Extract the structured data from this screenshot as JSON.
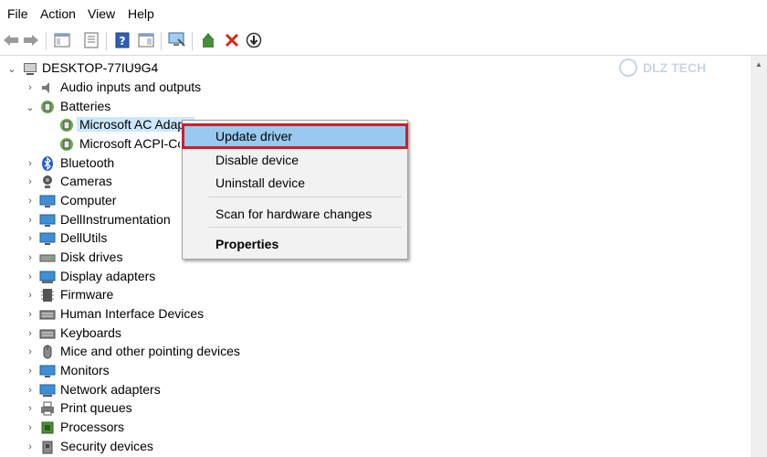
{
  "menubar": {
    "items": [
      "File",
      "Action",
      "View",
      "Help"
    ]
  },
  "toolbar": {
    "buttons": [
      "back-arrow-icon",
      "forward-arrow-icon",
      "console-tree-icon",
      "properties-icon",
      "help-icon",
      "action-pane-icon",
      "scan-hardware-icon",
      "update-driver-icon",
      "uninstall-icon",
      "disable-icon"
    ]
  },
  "watermark": {
    "text": "DLZ TECH"
  },
  "tree": {
    "root": "DESKTOP-77IU9G4",
    "items": [
      {
        "label": "Audio inputs and outputs",
        "level": 1,
        "expanded": false,
        "icon": "speaker-icon"
      },
      {
        "label": "Batteries",
        "level": 1,
        "expanded": true,
        "icon": "battery-icon"
      },
      {
        "label": "Microsoft AC Adapter",
        "level": 2,
        "icon": "battery-device-icon",
        "selected": true
      },
      {
        "label": "Microsoft ACPI-Compliant Control Method Battery",
        "level": 2,
        "icon": "battery-device-icon"
      },
      {
        "label": "Bluetooth",
        "level": 1,
        "expanded": false,
        "icon": "bluetooth-icon"
      },
      {
        "label": "Cameras",
        "level": 1,
        "expanded": false,
        "icon": "camera-icon"
      },
      {
        "label": "Computer",
        "level": 1,
        "expanded": false,
        "icon": "computer-icon"
      },
      {
        "label": "DellInstrumentation",
        "level": 1,
        "expanded": false,
        "icon": "monitor-icon"
      },
      {
        "label": "DellUtils",
        "level": 1,
        "expanded": false,
        "icon": "monitor-icon"
      },
      {
        "label": "Disk drives",
        "level": 1,
        "expanded": false,
        "icon": "disk-icon"
      },
      {
        "label": "Display adapters",
        "level": 1,
        "expanded": false,
        "icon": "display-adapter-icon"
      },
      {
        "label": "Firmware",
        "level": 1,
        "expanded": false,
        "icon": "chip-icon"
      },
      {
        "label": "Human Interface Devices",
        "level": 1,
        "expanded": false,
        "icon": "hid-icon"
      },
      {
        "label": "Keyboards",
        "level": 1,
        "expanded": false,
        "icon": "keyboard-icon"
      },
      {
        "label": "Mice and other pointing devices",
        "level": 1,
        "expanded": false,
        "icon": "mouse-icon"
      },
      {
        "label": "Monitors",
        "level": 1,
        "expanded": false,
        "icon": "monitor-icon"
      },
      {
        "label": "Network adapters",
        "level": 1,
        "expanded": false,
        "icon": "network-icon"
      },
      {
        "label": "Print queues",
        "level": 1,
        "expanded": false,
        "icon": "printer-icon"
      },
      {
        "label": "Processors",
        "level": 1,
        "expanded": false,
        "icon": "processor-icon"
      },
      {
        "label": "Security devices",
        "level": 1,
        "expanded": false,
        "icon": "security-icon"
      }
    ]
  },
  "context_menu": {
    "items": [
      {
        "label": "Update driver",
        "highlighted": true
      },
      {
        "label": "Disable device"
      },
      {
        "label": "Uninstall device"
      },
      {
        "separator": true
      },
      {
        "label": "Scan for hardware changes"
      },
      {
        "separator": true
      },
      {
        "label": "Properties",
        "bold": true
      }
    ]
  },
  "colors": {
    "highlight": "#99c9ef",
    "annotation_box": "#c8202e",
    "selection": "#cce8ff"
  }
}
